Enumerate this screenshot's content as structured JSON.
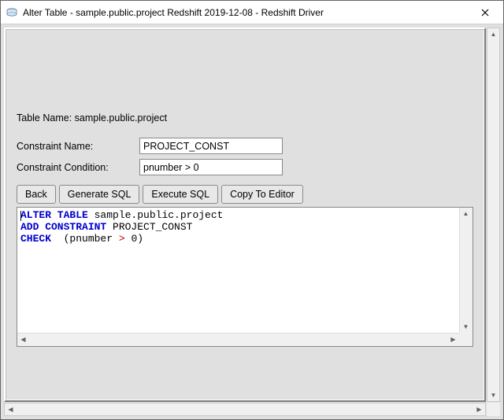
{
  "window": {
    "title": "Alter Table - sample.public.project Redshift 2019-12-08 - Redshift Driver"
  },
  "tableName": {
    "label": "Table Name: sample.public.project"
  },
  "form": {
    "constraintNameLabel": "Constraint Name:",
    "constraintNameValue": "PROJECT_CONST",
    "constraintConditionLabel": "Constraint Condition:",
    "constraintConditionValue": "pnumber > 0"
  },
  "buttons": {
    "back": "Back",
    "generateSQL": "Generate SQL",
    "executeSQL": "Execute SQL",
    "copyToEditor": "Copy To Editor"
  },
  "sql": {
    "kw_alter_table": "ALTER TABLE",
    "obj": " sample.public.project",
    "kw_add_constraint": "ADD CONSTRAINT",
    "constraint_name": " PROJECT_CONST",
    "kw_check": "CHECK",
    "check_open": "  (pnumber ",
    "op_gt": ">",
    "check_close": " 0)"
  },
  "scroll": {
    "up": "▲",
    "down": "▼",
    "left": "◀",
    "right": "▶"
  }
}
